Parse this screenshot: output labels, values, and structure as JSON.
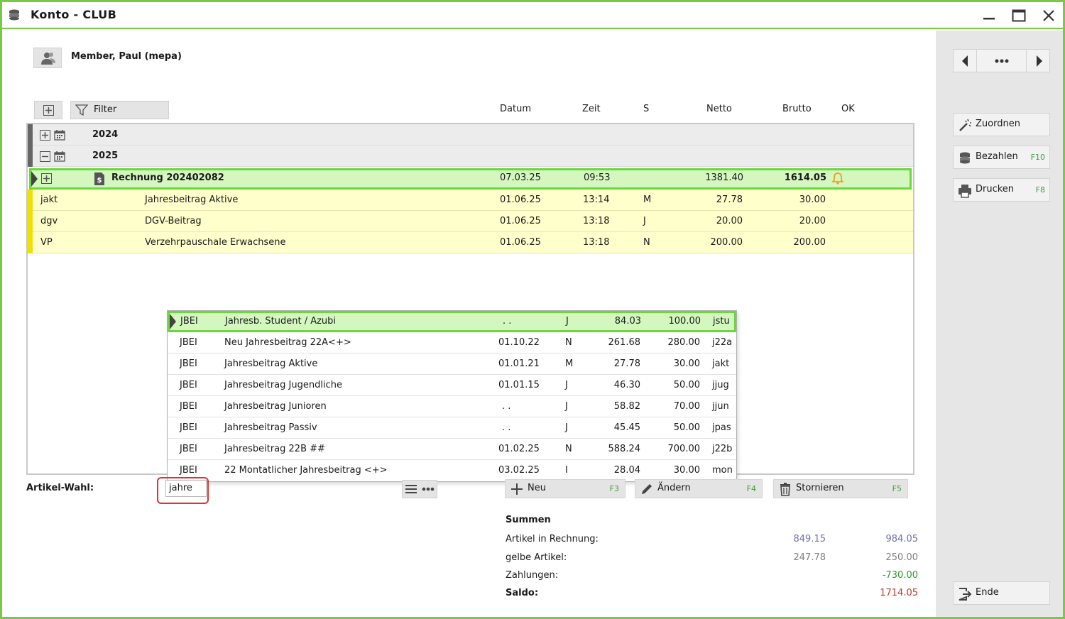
{
  "window": {
    "title": "Konto - CLUB"
  },
  "member": {
    "name": "Member, Paul (mepa)"
  },
  "toolbar": {
    "filter_label": "Filter"
  },
  "columns": {
    "datum": "Datum",
    "zeit": "Zeit",
    "s": "S",
    "netto": "Netto",
    "brutto": "Brutto",
    "ok": "OK"
  },
  "groups": [
    {
      "year": "2024"
    },
    {
      "year": "2025"
    }
  ],
  "invoice": {
    "title": "Rechnung 202402082",
    "datum": "07.03.25",
    "zeit": "09:53",
    "netto": "1381.40",
    "brutto": "1614.05"
  },
  "items": [
    {
      "code": "jakt",
      "name": "Jahresbeitrag Aktive",
      "datum": "01.06.25",
      "zeit": "13:14",
      "s": "M",
      "netto": "27.78",
      "brutto": "30.00"
    },
    {
      "code": "dgv",
      "name": "DGV-Beitrag",
      "datum": "01.06.25",
      "zeit": "13:18",
      "s": "J",
      "netto": "20.00",
      "brutto": "20.00"
    },
    {
      "code": "VP",
      "name": "Verzehrpauschale Erwachsene",
      "datum": "01.06.25",
      "zeit": "13:18",
      "s": "N",
      "netto": "200.00",
      "brutto": "200.00"
    }
  ],
  "popup": [
    {
      "grp": "JBEI",
      "name": "Jahresb. Student / Azubi",
      "date": ". .",
      "s": "J",
      "netto": "84.03",
      "brutto": "100.00",
      "code": "jstu"
    },
    {
      "grp": "JBEI",
      "name": "Neu Jahresbeitrag 22A<+>",
      "date": "01.10.22",
      "s": "N",
      "netto": "261.68",
      "brutto": "280.00",
      "code": "j22a"
    },
    {
      "grp": "JBEI",
      "name": "Jahresbeitrag Aktive",
      "date": "01.01.21",
      "s": "M",
      "netto": "27.78",
      "brutto": "30.00",
      "code": "jakt"
    },
    {
      "grp": "JBEI",
      "name": "Jahresbeitrag Jugendliche",
      "date": "01.01.15",
      "s": "J",
      "netto": "46.30",
      "brutto": "50.00",
      "code": "jjug"
    },
    {
      "grp": "JBEI",
      "name": "Jahresbeitrag Junioren",
      "date": ". .",
      "s": "J",
      "netto": "58.82",
      "brutto": "70.00",
      "code": "jjun"
    },
    {
      "grp": "JBEI",
      "name": "Jahresbeitrag Passiv",
      "date": ". .",
      "s": "J",
      "netto": "45.45",
      "brutto": "50.00",
      "code": "jpas"
    },
    {
      "grp": "JBEI",
      "name": "Jahresbeitrag 22B ##",
      "date": "01.02.25",
      "s": "N",
      "netto": "588.24",
      "brutto": "700.00",
      "code": "j22b"
    },
    {
      "grp": "JBEI",
      "name": "22 Montatlicher Jahresbeitrag <+>",
      "date": "03.02.25",
      "s": "I",
      "netto": "28.04",
      "brutto": "30.00",
      "code": "mon"
    }
  ],
  "artikel": {
    "label": "Artikel-Wahl:",
    "value": "jahre"
  },
  "actions": {
    "neu": {
      "label": "Neu",
      "key": "F3"
    },
    "aendern": {
      "label": "Ändern",
      "key": "F4"
    },
    "stornieren": {
      "label": "Stornieren",
      "key": "F5"
    }
  },
  "summen": {
    "title": "Summen",
    "rows": [
      {
        "label": "Artikel in Rechnung:",
        "netto": "849.15",
        "brutto": "984.05"
      },
      {
        "label": "gelbe Artikel:",
        "netto": "247.78",
        "brutto": "250.00"
      },
      {
        "label": "Zahlungen:",
        "brutto": "-730.00"
      },
      {
        "label": "Saldo:",
        "brutto": "1714.05"
      }
    ]
  },
  "side": {
    "zuordnen": {
      "label": "Zuordnen"
    },
    "bezahlen": {
      "label": "Bezahlen",
      "key": "F10"
    },
    "drucken": {
      "label": "Drucken",
      "key": "F8"
    },
    "ende": {
      "label": "Ende"
    }
  },
  "colors": {
    "accent": "#7ac943",
    "yellow_row": "#ffffcc",
    "selected_row": "#d4f7c0",
    "marker": "#f0e000",
    "bell": "#f0a020",
    "negative_green": "#2a9a2a",
    "saldo_red": "#c0392b",
    "netto_purple": "#7070b0"
  }
}
